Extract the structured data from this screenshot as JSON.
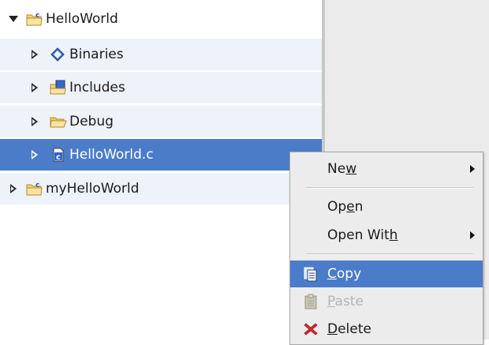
{
  "tree": {
    "items": [
      {
        "label": "HelloWorld",
        "icon": "c-project-folder-icon",
        "expanded": true
      },
      {
        "label": "Binaries",
        "icon": "binaries-diamond-icon"
      },
      {
        "label": "Includes",
        "icon": "includes-folder-icon"
      },
      {
        "label": "Debug",
        "icon": "folder-icon"
      },
      {
        "label": "HelloWorld.c",
        "icon": "c-source-file-icon",
        "selected": true
      },
      {
        "label": "myHelloWorld",
        "icon": "c-project-folder-icon",
        "expanded": false
      }
    ]
  },
  "context_menu": {
    "new": {
      "before": "Ne",
      "mnemonic": "w",
      "after": ""
    },
    "open": {
      "before": "Op",
      "mnemonic": "e",
      "after": "n"
    },
    "open_with": {
      "before": "Open Wit",
      "mnemonic": "h",
      "after": ""
    },
    "copy": {
      "before": "",
      "mnemonic": "C",
      "after": "opy"
    },
    "paste": {
      "before": "",
      "mnemonic": "P",
      "after": "aste"
    },
    "delete": {
      "before": "",
      "mnemonic": "D",
      "after": "elete"
    }
  },
  "colors": {
    "selection": "#4a7cc9",
    "row_highlight": "#eef2f9",
    "menu_background": "#ececec",
    "side_panel": "#ebebeb",
    "disabled_text": "#b4b4b4"
  }
}
